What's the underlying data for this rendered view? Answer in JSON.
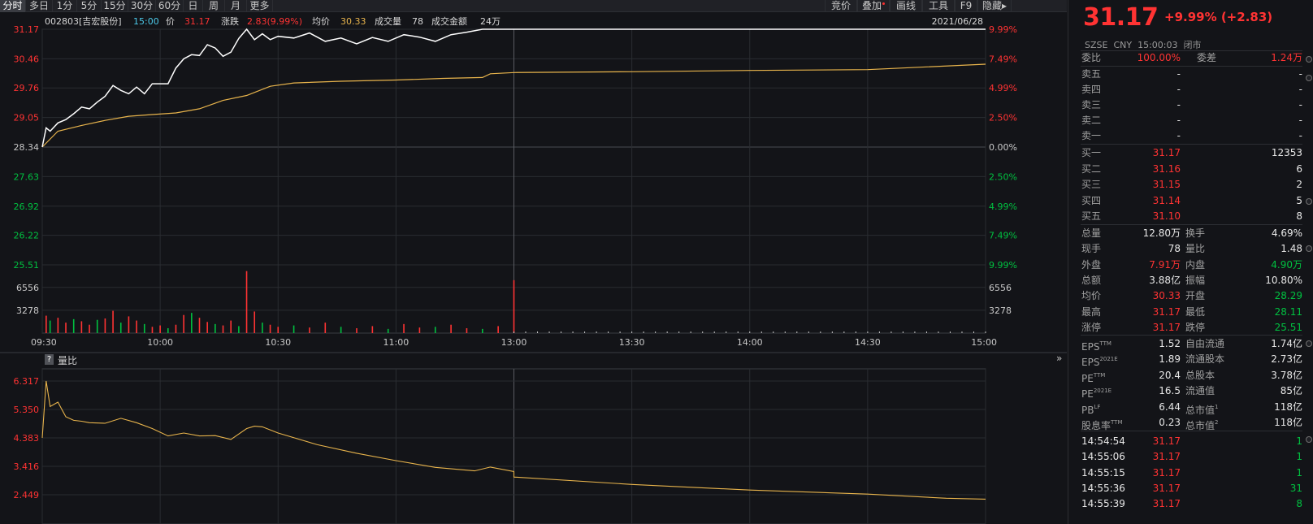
{
  "toolbar": {
    "tabs": [
      "分时",
      "多日",
      "1分",
      "5分",
      "15分",
      "30分",
      "60分",
      "日",
      "周",
      "月",
      "更多"
    ],
    "active_tab": "分时",
    "right_buttons": [
      "竞价",
      "叠加",
      "画线",
      "工具",
      "F9",
      "隐藏"
    ]
  },
  "info_bar": {
    "code_name": "002803[吉宏股份]",
    "time": "15:00",
    "price_label": "价",
    "price": "31.17",
    "change_label": "涨跌",
    "change": "2.83(9.99%)",
    "avg_label": "均价",
    "avg": "30.33",
    "vol_label": "成交量",
    "vol": "78",
    "amt_label": "成交金额",
    "amt": "24万",
    "date": "2021/06/28"
  },
  "price_axis": {
    "left": [
      "31.17",
      "30.46",
      "29.76",
      "29.05",
      "28.34",
      "27.63",
      "26.92",
      "26.22",
      "25.51"
    ],
    "right": [
      "9.99%",
      "7.49%",
      "4.99%",
      "2.50%",
      "0.00%",
      "2.50%",
      "4.99%",
      "7.49%",
      "9.99%"
    ]
  },
  "volume_axis": {
    "left": [
      "6556",
      "3278"
    ],
    "right": [
      "6556",
      "3278"
    ]
  },
  "time_axis": [
    "09:30",
    "10:00",
    "10:30",
    "11:00",
    "13:00",
    "13:30",
    "14:00",
    "14:30",
    "15:00"
  ],
  "volume_ratio_panel": {
    "help": "?",
    "label": "量比",
    "axis": [
      "6.317",
      "5.350",
      "4.383",
      "3.416",
      "2.449"
    ]
  },
  "chart_data": {
    "type": "line",
    "series": [
      {
        "name": "价",
        "x": [
          "09:30",
          "09:31",
          "09:32",
          "09:34",
          "09:36",
          "09:38",
          "09:40",
          "09:42",
          "09:44",
          "09:46",
          "09:48",
          "09:50",
          "09:52",
          "09:54",
          "09:56",
          "09:58",
          "10:00",
          "10:02",
          "10:04",
          "10:06",
          "10:08",
          "10:10",
          "10:12",
          "10:14",
          "10:16",
          "10:18",
          "10:20",
          "10:22",
          "10:24",
          "10:26",
          "10:28",
          "10:30",
          "10:34",
          "10:38",
          "10:42",
          "10:46",
          "10:50",
          "10:54",
          "10:58",
          "11:02",
          "11:06",
          "11:10",
          "11:14",
          "11:18",
          "11:22",
          "11:26",
          "11:30",
          "13:00",
          "13:30",
          "14:00",
          "14:30",
          "15:00"
        ],
        "values": [
          28.34,
          28.8,
          28.72,
          28.92,
          29.0,
          29.14,
          29.3,
          29.26,
          29.42,
          29.56,
          29.82,
          29.7,
          29.62,
          29.78,
          29.62,
          29.86,
          29.86,
          29.86,
          30.24,
          30.46,
          30.56,
          30.54,
          30.8,
          30.72,
          30.52,
          30.62,
          30.95,
          31.17,
          30.92,
          31.06,
          30.92,
          31.0,
          30.96,
          31.08,
          30.88,
          30.96,
          30.82,
          30.97,
          30.88,
          31.04,
          30.98,
          30.88,
          31.04,
          31.1,
          31.17,
          31.17,
          31.17,
          31.17,
          31.17,
          31.17,
          31.17,
          31.17
        ]
      },
      {
        "name": "均价",
        "x": [
          "09:30",
          "09:34",
          "09:40",
          "09:46",
          "09:52",
          "09:58",
          "10:04",
          "10:10",
          "10:16",
          "10:22",
          "10:28",
          "10:34",
          "10:46",
          "11:00",
          "11:12",
          "11:22",
          "11:24",
          "13:00",
          "13:30",
          "14:00",
          "14:30",
          "15:00"
        ],
        "values": [
          28.34,
          28.72,
          28.86,
          28.98,
          29.08,
          29.12,
          29.16,
          29.26,
          29.46,
          29.58,
          29.8,
          29.88,
          29.92,
          29.95,
          29.99,
          30.01,
          30.1,
          30.13,
          30.15,
          30.18,
          30.2,
          30.33
        ]
      }
    ],
    "volume": {
      "x": [
        "09:31",
        "09:32",
        "09:34",
        "09:36",
        "09:38",
        "09:40",
        "09:42",
        "09:44",
        "09:46",
        "09:48",
        "09:50",
        "09:52",
        "09:54",
        "09:56",
        "09:58",
        "10:00",
        "10:02",
        "10:04",
        "10:06",
        "10:08",
        "10:10",
        "10:12",
        "10:14",
        "10:16",
        "10:18",
        "10:20",
        "10:22",
        "10:24",
        "10:26",
        "10:28",
        "10:30",
        "10:34",
        "10:38",
        "10:42",
        "10:46",
        "10:50",
        "10:54",
        "10:58",
        "11:02",
        "11:06",
        "11:10",
        "11:14",
        "11:18",
        "11:22",
        "11:26",
        "11:30"
      ],
      "values": [
        2500,
        1800,
        2200,
        1500,
        2000,
        1700,
        1200,
        1900,
        2100,
        3200,
        1500,
        2400,
        1800,
        1300,
        900,
        1100,
        700,
        1200,
        2600,
        2900,
        2200,
        1600,
        1300,
        1100,
        1800,
        1000,
        8900,
        3100,
        1500,
        1200,
        900,
        1100,
        800,
        1500,
        900,
        700,
        1000,
        600,
        1300,
        800,
        900,
        1200,
        700,
        600,
        1000,
        7600
      ]
    },
    "volume_ratio": {
      "x": [
        "09:30",
        "09:31",
        "09:32",
        "09:34",
        "09:36",
        "09:38",
        "09:40",
        "09:42",
        "09:46",
        "09:50",
        "09:54",
        "09:58",
        "10:02",
        "10:06",
        "10:10",
        "10:14",
        "10:18",
        "10:22",
        "10:24",
        "10:26",
        "10:30",
        "10:40",
        "10:50",
        "11:00",
        "11:10",
        "11:20",
        "11:24",
        "11:30",
        "13:00",
        "13:30",
        "14:00",
        "14:30",
        "14:50",
        "15:00"
      ],
      "values": [
        4.383,
        6.317,
        5.45,
        5.6,
        5.1,
        4.98,
        4.95,
        4.9,
        4.88,
        5.05,
        4.9,
        4.7,
        4.45,
        4.55,
        4.45,
        4.46,
        4.33,
        4.7,
        4.78,
        4.76,
        4.55,
        4.15,
        3.86,
        3.61,
        3.38,
        3.26,
        3.39,
        3.24,
        3.05,
        2.8,
        2.61,
        2.47,
        2.33,
        2.3
      ]
    },
    "colors": {
      "price": "#ffffff",
      "avg": "#e8b44c",
      "ratio": "#e8b44c",
      "up": "#ff3333",
      "down": "#00c040",
      "grid": "#2a2c31"
    },
    "ylim": [
      25.51,
      31.17
    ],
    "prev_close": 28.34
  },
  "quote": {
    "price": "31.17",
    "change_text": "+9.99% (+2.83)",
    "exchange": "SZSE",
    "currency": "CNY",
    "time": "15:00:03",
    "status": "闭市",
    "wb_label": "委比",
    "wb_value": "100.00%",
    "wc_label": "委差",
    "wc_value": "1.24万",
    "asks": [
      {
        "label": "卖五",
        "price": "-",
        "vol": "-"
      },
      {
        "label": "卖四",
        "price": "-",
        "vol": "-"
      },
      {
        "label": "卖三",
        "price": "-",
        "vol": "-"
      },
      {
        "label": "卖二",
        "price": "-",
        "vol": "-"
      },
      {
        "label": "卖一",
        "price": "-",
        "vol": "-"
      }
    ],
    "bids": [
      {
        "label": "买一",
        "price": "31.17",
        "vol": "12353"
      },
      {
        "label": "买二",
        "price": "31.16",
        "vol": "6"
      },
      {
        "label": "买三",
        "price": "31.15",
        "vol": "2"
      },
      {
        "label": "买四",
        "price": "31.14",
        "vol": "5"
      },
      {
        "label": "买五",
        "price": "31.10",
        "vol": "8"
      }
    ],
    "stats": [
      {
        "l1": "总量",
        "v1": "12.80万",
        "c1": "white",
        "l2": "换手",
        "v2": "4.69%",
        "c2": "white"
      },
      {
        "l1": "现手",
        "v1": "78",
        "c1": "white",
        "l2": "量比",
        "v2": "1.48",
        "c2": "white"
      },
      {
        "l1": "外盘",
        "v1": "7.91万",
        "c1": "red",
        "l2": "内盘",
        "v2": "4.90万",
        "c2": "green"
      },
      {
        "l1": "总额",
        "v1": "3.88亿",
        "c1": "white",
        "l2": "振幅",
        "v2": "10.80%",
        "c2": "white"
      },
      {
        "l1": "均价",
        "v1": "30.33",
        "c1": "red",
        "l2": "开盘",
        "v2": "28.29",
        "c2": "green"
      },
      {
        "l1": "最高",
        "v1": "31.17",
        "c1": "red",
        "l2": "最低",
        "v2": "28.11",
        "c2": "green"
      },
      {
        "l1": "涨停",
        "v1": "31.17",
        "c1": "red",
        "l2": "跌停",
        "v2": "25.51",
        "c2": "green"
      }
    ],
    "fundamentals": [
      {
        "l1": "EPS",
        "s1": "TTM",
        "v1": "1.52",
        "l2": "自由流通",
        "s2": "",
        "v2": "1.74亿"
      },
      {
        "l1": "EPS",
        "s1": "2021E",
        "v1": "1.89",
        "l2": "流通股本",
        "s2": "",
        "v2": "2.73亿"
      },
      {
        "l1": "PE",
        "s1": "TTM",
        "v1": "20.4",
        "l2": "总股本",
        "s2": "",
        "v2": "3.78亿"
      },
      {
        "l1": "PE",
        "s1": "2021E",
        "v1": "16.5",
        "l2": "流通值",
        "s2": "",
        "v2": "85亿"
      },
      {
        "l1": "PB",
        "s1": "LF",
        "v1": "6.44",
        "l2": "总市值",
        "s2": "1",
        "v2": "118亿"
      },
      {
        "l1": "股息率",
        "s1": "TTM",
        "v1": "0.23",
        "l2": "总市值",
        "s2": "2",
        "v2": "118亿"
      }
    ],
    "ticks": [
      {
        "time": "14:54:54",
        "price": "31.17",
        "vol": "1"
      },
      {
        "time": "14:55:06",
        "price": "31.17",
        "vol": "1"
      },
      {
        "time": "14:55:15",
        "price": "31.17",
        "vol": "1"
      },
      {
        "time": "14:55:36",
        "price": "31.17",
        "vol": "31"
      },
      {
        "time": "14:55:39",
        "price": "31.17",
        "vol": "8"
      }
    ]
  },
  "collapse_arrow": "»"
}
